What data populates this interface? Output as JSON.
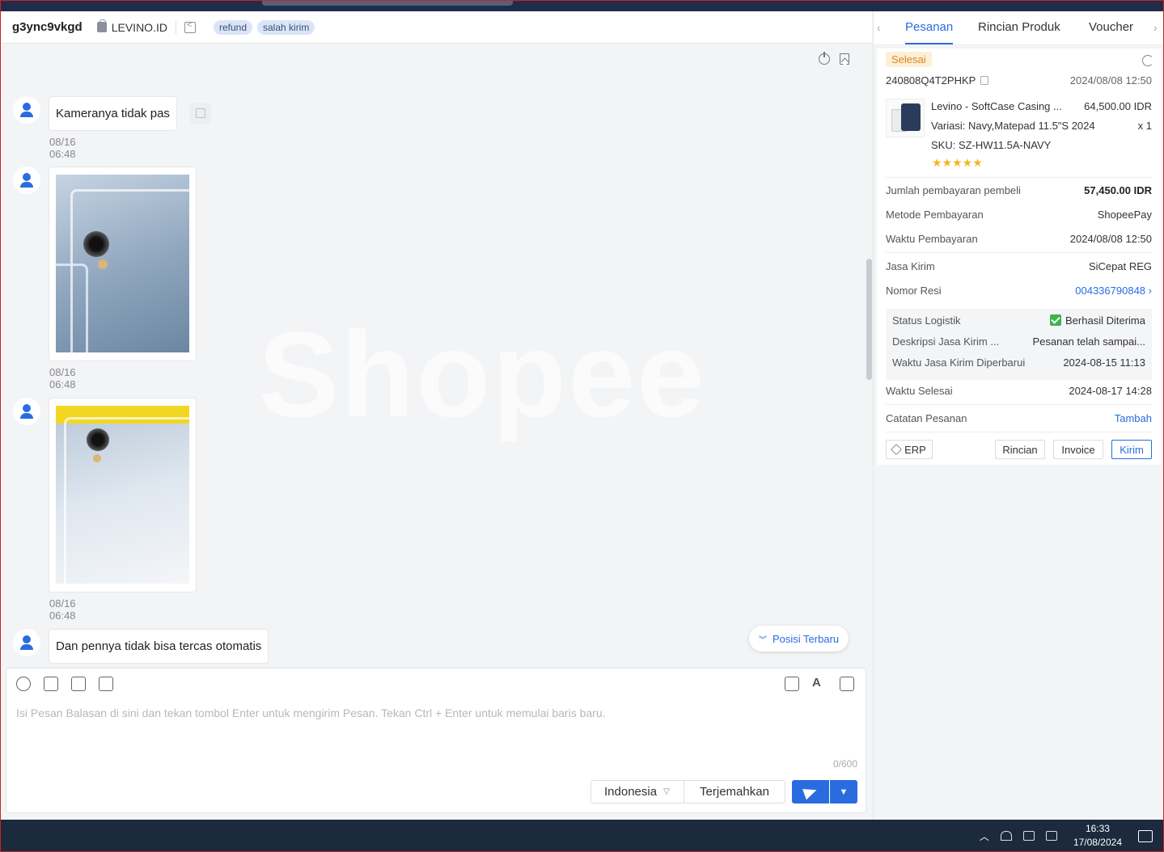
{
  "chat": {
    "username": "g3ync9vkgd",
    "shop": "LEVINO.ID",
    "tags": [
      "refund",
      "salah kirim"
    ],
    "watermark": "Shopee",
    "messages": [
      {
        "type": "text",
        "text": "Kameranya tidak pas",
        "time": "08/16 06:48"
      },
      {
        "type": "image",
        "time": "08/16 06:48"
      },
      {
        "type": "image",
        "time": "08/16 06:48"
      },
      {
        "type": "text",
        "text": "Dan pennya tidak bisa tercas otomatis"
      }
    ],
    "latest_button": "Posisi Terbaru"
  },
  "composer": {
    "placeholder": "Isi Pesan Balasan di sini dan tekan tombol Enter untuk mengirim Pesan. Tekan Ctrl + Enter untuk memulai baris baru.",
    "counter": "0/600",
    "language": "Indonesia",
    "translate_label": "Terjemahkan"
  },
  "panel": {
    "tabs": [
      "Pesanan",
      "Rincian Produk",
      "Voucher"
    ],
    "order": {
      "status": "Selesai",
      "id": "240808Q4T2PHKP",
      "date": "2024/08/08 12:50",
      "product": {
        "name": "Levino - SoftCase Casing ...",
        "price": "64,500.00 IDR",
        "variant": "Variasi:  Navy,Matepad 11.5\"S 2024",
        "qty": "x 1",
        "sku": "SKU:  SZ-HW11.5A-NAVY",
        "stars": "★★★★★"
      },
      "fields": {
        "payment_total_label": "Jumlah pembayaran pembeli",
        "payment_total": "57,450.00 IDR",
        "payment_method_label": "Metode Pembayaran",
        "payment_method": "ShopeePay",
        "payment_time_label": "Waktu Pembayaran",
        "payment_time": "2024/08/08 12:50",
        "courier_label": "Jasa Kirim",
        "courier": "SiCepat REG",
        "resi_label": "Nomor Resi",
        "resi": "004336790848",
        "logistic_status_label": "Status Logistik",
        "logistic_status": "Berhasil Diterima",
        "courier_desc_label": "Deskripsi Jasa Kirim ...",
        "courier_desc": "Pesanan telah sampai...",
        "courier_update_label": "Waktu Jasa Kirim Diperbarui",
        "courier_update": "2024-08-15 11:13",
        "finished_label": "Waktu Selesai",
        "finished": "2024-08-17 14:28",
        "note_label": "Catatan Pesanan",
        "note_action": "Tambah"
      },
      "buttons": {
        "erp": "ERP",
        "detail": "Rincian",
        "invoice": "Invoice",
        "send": "Kirim"
      }
    }
  },
  "taskbar": {
    "time": "16:33",
    "date": "17/08/2024"
  }
}
